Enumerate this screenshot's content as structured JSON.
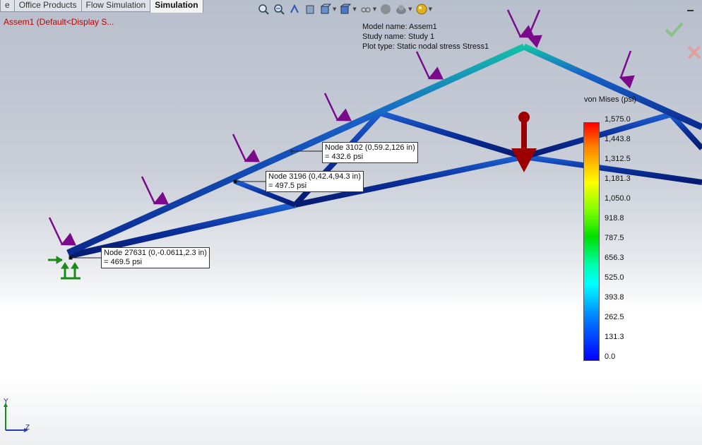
{
  "tabs": [
    {
      "label": "e"
    },
    {
      "label": "Office Products"
    },
    {
      "label": "Flow Simulation"
    },
    {
      "label": "Simulation",
      "active": true
    }
  ],
  "document_title": "Assem1  (Default<Display S...",
  "hud_icons": [
    "zoom-to-fit-icon",
    "zoom-area-icon",
    "previous-view-icon",
    "section-view-icon",
    "view-orientation-icon",
    "display-style-icon",
    "hide-show-icon",
    "edit-appearance-icon",
    "apply-scene-icon",
    "view-settings-icon"
  ],
  "plot_info": {
    "model_name": "Model name: Assem1",
    "study_name": "Study name: Study 1",
    "plot_type": "Plot type: Static nodal stress Stress1"
  },
  "probes": [
    {
      "line1": "Node 3102 (0,59.2,126 in)",
      "line2": "= 432.6    psi"
    },
    {
      "line1": "Node 3196 (0,42.4,94.3 in)",
      "line2": "= 497.5    psi"
    },
    {
      "line1": "Node 27631 (0,-0.0611,2.3 in)",
      "line2": "= 469.5    psi"
    }
  ],
  "legend": {
    "title": "von Mises (psi)",
    "ticks": [
      "1,575.0",
      "1,443.8",
      "1,312.5",
      "1,181.3",
      "1,050.0",
      "918.8",
      "787.5",
      "656.3",
      "525.0",
      "393.8",
      "262.5",
      "131.3",
      "0.0"
    ],
    "colors": {
      "max": "#ff0000",
      "min": "#0000ff"
    }
  },
  "triad": {
    "y_label": "Y",
    "z_label": "Z"
  },
  "colors": {
    "load_arrow": "#7a0a8a",
    "fixture": "#1a8a1a",
    "gravity": "#9a0000",
    "beam": "#0a2a9a"
  }
}
